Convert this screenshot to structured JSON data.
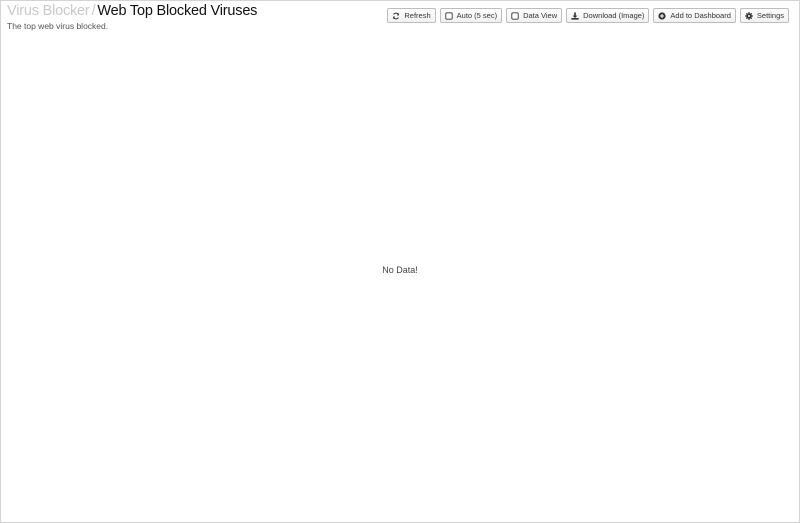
{
  "breadcrumb": {
    "parent": "Virus Blocker",
    "separator": "/",
    "title": "Web Top Blocked Viruses"
  },
  "subtitle": "The top web virus blocked.",
  "toolbar": {
    "refresh": {
      "label": "Refresh",
      "icon": "refresh-icon"
    },
    "auto": {
      "label": "Auto (5 sec)",
      "icon": "checkbox-icon",
      "checked": false
    },
    "data_view": {
      "label": "Data View",
      "icon": "checkbox-icon",
      "checked": false
    },
    "download": {
      "label": "Download (Image)",
      "icon": "download-icon"
    },
    "add_dashboard": {
      "label": "Add to Dashboard",
      "icon": "plus-circle-icon"
    },
    "settings": {
      "label": "Settings",
      "icon": "gear-icon"
    }
  },
  "chart": {
    "empty_message": "No Data!"
  },
  "colors": {
    "breadcrumb_parent": "#c9c9c9",
    "border": "#d4d4d4"
  }
}
